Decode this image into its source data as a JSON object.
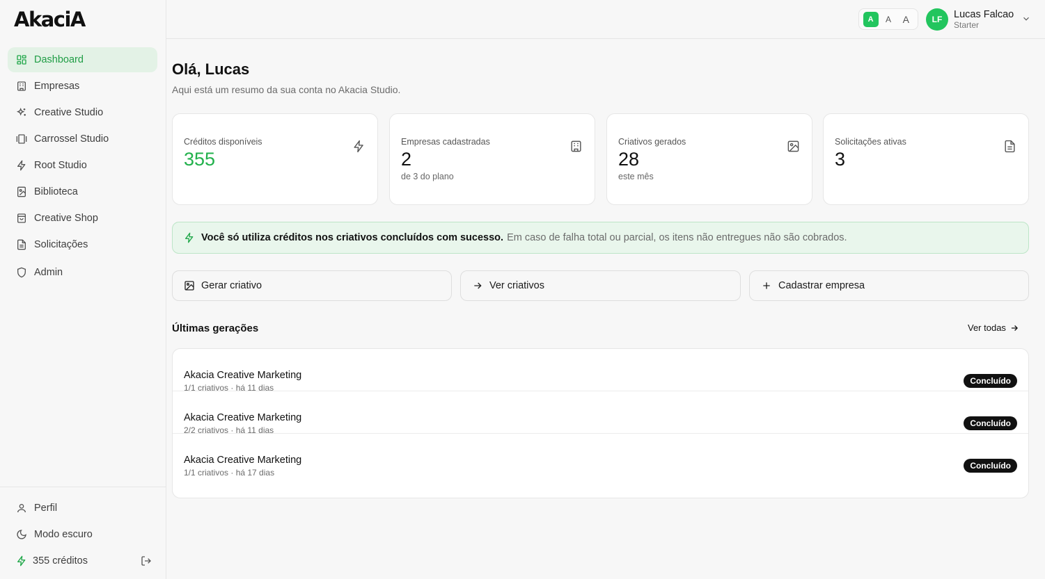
{
  "app": {
    "logo_text": "AkaciA"
  },
  "sidebar": {
    "items": [
      {
        "label": "Dashboard",
        "icon": "layout-grid-icon",
        "active": true
      },
      {
        "label": "Empresas",
        "icon": "building-icon"
      },
      {
        "label": "Creative Studio",
        "icon": "sparkles-icon"
      },
      {
        "label": "Carrossel Studio",
        "icon": "gallery-icon"
      },
      {
        "label": "Root Studio",
        "icon": "zap-icon"
      },
      {
        "label": "Biblioteca",
        "icon": "library-icon"
      },
      {
        "label": "Creative Shop",
        "icon": "shopping-bag-icon"
      },
      {
        "label": "Solicitações",
        "icon": "file-text-icon"
      },
      {
        "label": "Admin",
        "icon": "shield-icon"
      }
    ],
    "bottom": {
      "profile_label": "Perfil",
      "dark_mode_label": "Modo escuro",
      "credits_label": "355 créditos"
    }
  },
  "header": {
    "font_sizes": [
      "A",
      "A",
      "A"
    ],
    "avatar_initials": "LF",
    "user_name": "Lucas Falcao",
    "user_plan": "Starter"
  },
  "main": {
    "greeting": "Olá, Lucas",
    "subtitle": "Aqui está um resumo da sua conta no Akacia Studio.",
    "stats": [
      {
        "label": "Créditos disponíveis",
        "value": "355",
        "sub": "",
        "icon": "zap-icon"
      },
      {
        "label": "Empresas cadastradas",
        "value": "2",
        "sub": "de 3 do plano",
        "icon": "building-icon"
      },
      {
        "label": "Criativos gerados",
        "value": "28",
        "sub": "este mês",
        "icon": "image-icon"
      },
      {
        "label": "Solicitações ativas",
        "value": "3",
        "sub": "",
        "icon": "file-text-icon"
      }
    ],
    "notice": {
      "strong": "Você só utiliza créditos nos criativos concluídos com sucesso.",
      "rest": "Em caso de falha total ou parcial, os itens não entregues não são cobrados."
    },
    "actions": [
      {
        "label": "Gerar criativo",
        "icon": "image-icon"
      },
      {
        "label": "Ver criativos",
        "icon": "arrow-right-icon"
      },
      {
        "label": "Cadastrar empresa",
        "icon": "plus-icon"
      }
    ],
    "recent": {
      "title": "Últimas gerações",
      "see_all": "Ver todas",
      "rows": [
        {
          "title": "Akacia Creative Marketing",
          "sub": "1/1 criativos · há 11 dias",
          "status": "Concluído"
        },
        {
          "title": "Akacia Creative Marketing",
          "sub": "2/2 criativos · há 11 dias",
          "status": "Concluído"
        },
        {
          "title": "Akacia Creative Marketing",
          "sub": "1/1 criativos · há 17 dias",
          "status": "Concluído"
        }
      ]
    }
  },
  "colors": {
    "accent": "#22c55e",
    "accent_text": "#1f9d45",
    "notice_bg": "#e9f6ec",
    "badge_bg": "#111111"
  }
}
